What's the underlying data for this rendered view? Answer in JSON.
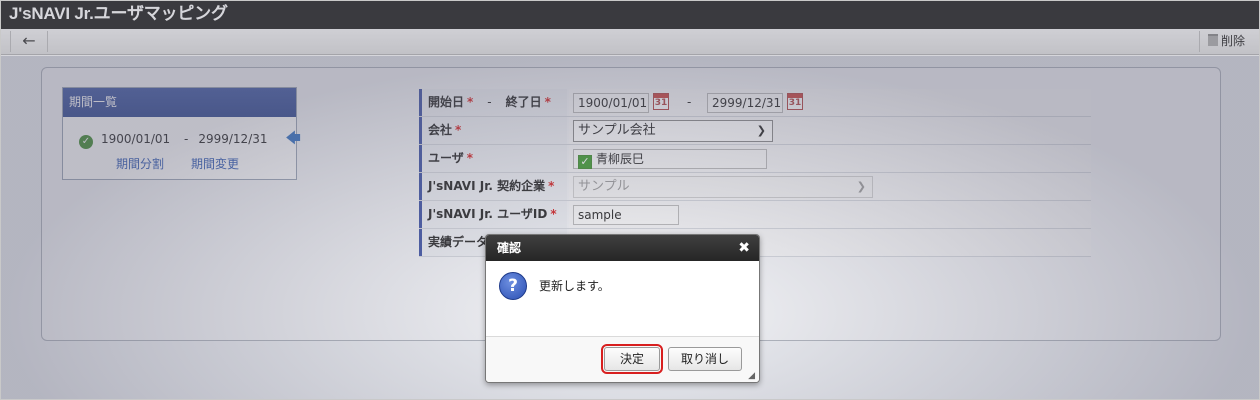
{
  "window": {
    "title": "J'sNAVI Jr.ユーザマッピング"
  },
  "toolbar": {
    "back_label": "←",
    "delete_label": "削除"
  },
  "period_list": {
    "header": "期間一覧",
    "range_start": "1900/01/01",
    "range_sep": "-",
    "range_end": "2999/12/31",
    "split_link": "期間分割",
    "change_link": "期間変更"
  },
  "form": {
    "required_mark": "*",
    "dates": {
      "start_label": "開始日",
      "end_label": "終了日",
      "sep": "-",
      "start_value": "1900/01/01",
      "end_value": "2999/12/31",
      "cal_day": "31"
    },
    "company": {
      "label": "会社",
      "value": "サンプル会社"
    },
    "user": {
      "label": "ユーザ",
      "value": "青柳辰巳"
    },
    "contract": {
      "label": "J'sNAVI Jr. 契約企業",
      "value": "サンプル"
    },
    "user_id": {
      "label": "J'sNAVI Jr. ユーザID",
      "value": "sample"
    },
    "results": {
      "label": "実績データ"
    }
  },
  "dialog": {
    "title": "確認",
    "close": "✖",
    "message": "更新します。",
    "ok_label": "決定",
    "cancel_label": "取り消し"
  },
  "colors": {
    "accent": "#2b448f",
    "highlight": "#d81f1f"
  }
}
